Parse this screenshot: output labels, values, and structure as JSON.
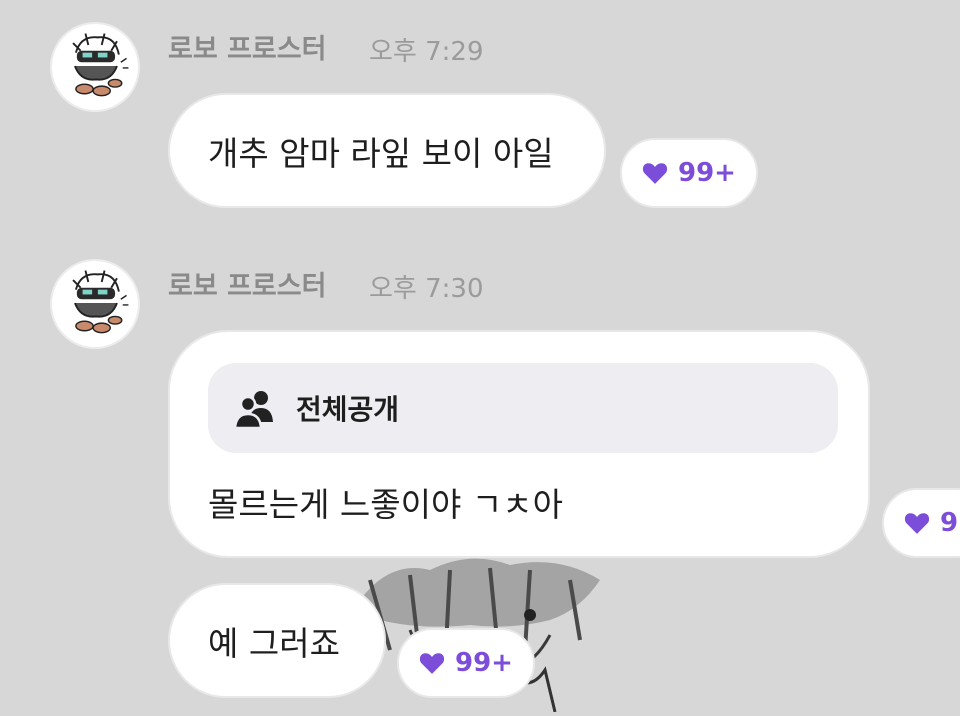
{
  "messages": [
    {
      "author": "로보 프로스터",
      "time": "오후 7:29",
      "text": "개추 암마 라잎 보이 아일",
      "likes": "99+"
    },
    {
      "author": "로보 프로스터",
      "time": "오후 7:30",
      "visibility": "전체공개",
      "text": "몰르는게 느좋이야 ㄱㅊ아",
      "likes": "9"
    },
    {
      "text": "예 그러죠",
      "likes": "99+"
    }
  ],
  "icons": {
    "avatar": "avatar-doodle-icon",
    "like": "heart-icon",
    "visibility": "people-icon"
  },
  "colors": {
    "background": "#d7d7d7",
    "bubble": "#ffffff",
    "like_accent": "#7c4dd8",
    "author_name": "#8a8a8a",
    "scope_chip": "#eeeef2"
  }
}
